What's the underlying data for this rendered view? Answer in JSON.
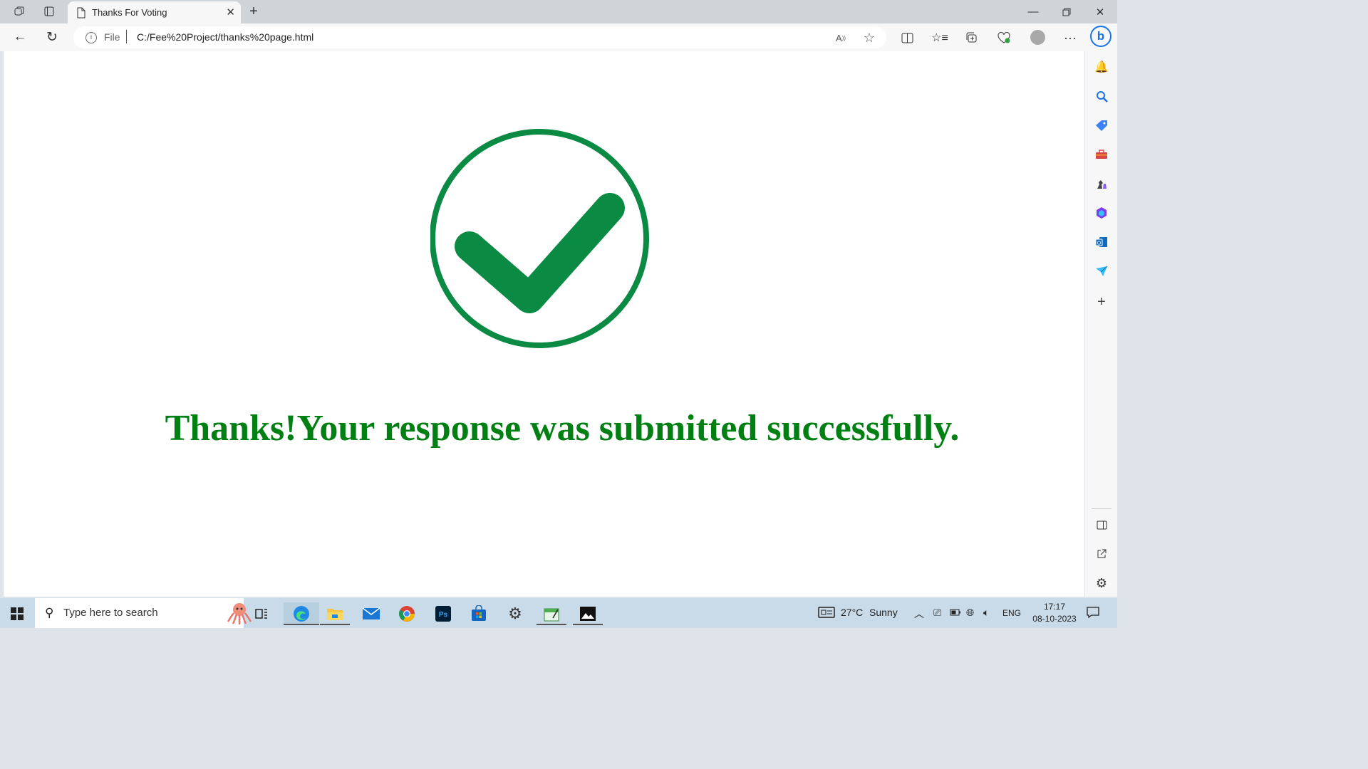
{
  "browser": {
    "tab_title": "Thanks For Voting",
    "address": {
      "scheme_label": "File",
      "url": "C:/Fee%20Project/thanks%20page.html"
    }
  },
  "page": {
    "message": "Thanks!Your response was submitted successfully.",
    "accent_color": "#0b8a43",
    "message_color": "#008013"
  },
  "taskbar": {
    "search_placeholder": "Type here to search",
    "weather_temp": "27°C",
    "weather_text": "Sunny",
    "language": "ENG",
    "time": "17:17",
    "date": "08-10-2023",
    "pinned": [
      "task-view",
      "edge",
      "file-explorer",
      "mail",
      "chrome",
      "photoshop",
      "store",
      "settings",
      "notepad",
      "photos"
    ]
  },
  "sidebar_icons": [
    "bell",
    "search",
    "shopping-tag",
    "tools",
    "games",
    "microsoft-365",
    "outlook",
    "send",
    "add"
  ]
}
